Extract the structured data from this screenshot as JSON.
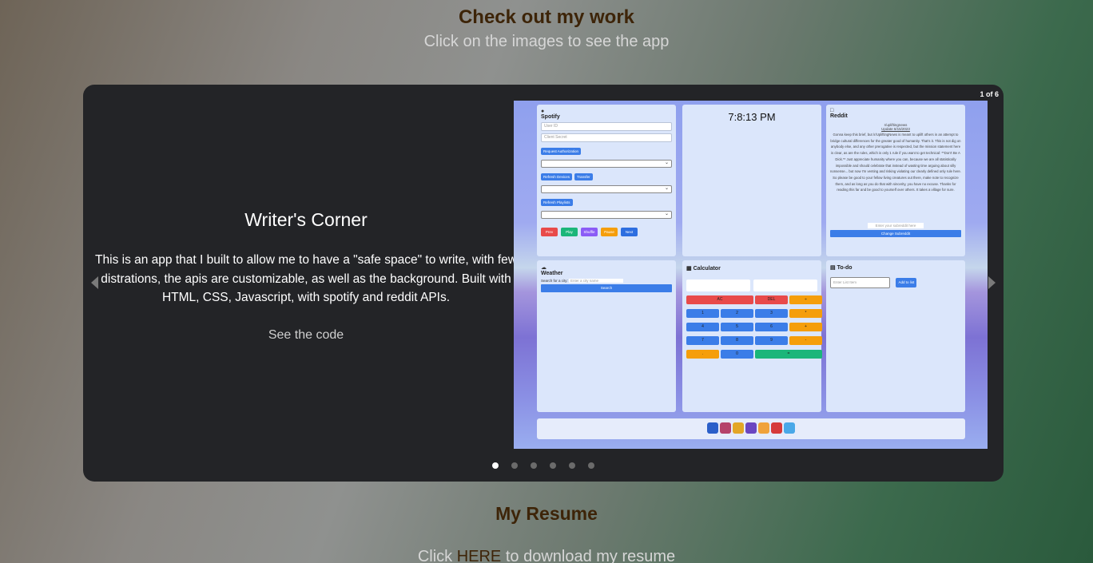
{
  "header": {
    "title": "Check out my work",
    "subtitle": "Click on the images to see the app"
  },
  "carousel": {
    "counter": "1 of 6",
    "slide_count": 6,
    "active_index": 0,
    "project": {
      "title": "Writer's Corner",
      "description": "This is an app that I built to allow me to have a \"safe space\" to write, with few distrations, the apis are customizable, as well as the background. Built with HTML, CSS, Javascript, with spotify and reddit APIs.",
      "link_label": "See the code"
    },
    "preview": {
      "spotify": {
        "icon": "spotify-icon",
        "title": "Spotify",
        "user_id_placeholder": "User ID",
        "client_secret_placeholder": "Client Secret",
        "request_auth": "Request Authorization",
        "refresh_devices": "Refresh Devices",
        "transfer": "Transfer",
        "refresh_playlists": "Refresh Playlists",
        "controls": [
          "Prev",
          "Play",
          "Shuffle",
          "Pause",
          "Next"
        ]
      },
      "clock": {
        "time": "7:8:13 PM"
      },
      "reddit": {
        "icon": "trash-icon",
        "title": "Reddit",
        "subreddit": "r/upliftingnews",
        "update": "Update 6/15/2023",
        "body": "Gonna keep this brief, but /r/UpliftingNews is meant to uplift others in an attempt to bridge cultural differences for the greater good of humanity. That's it. This is not dig on anybody else, and any other prerogative is respected, but the mission statement here is clear, as are the rules, which is only 1 rule if you want to get technical: **Don't Be A Dick.** Just appreciate humanity where you can, because we are all statistically impossible and should celebrate that instead of wasting time arguing about silly nonsense... but now I'm venting and risking violating our clearly defined only rule here. So please be good to your fellow living creatures out there, make note to recognize them, and as long as you do that with sincerity, you have no excuse. Thanks for reading this far and be good to yourself over others. It takes a village for sure.",
        "input_placeholder": "Enter your subreddit here",
        "button": "Change Subreddit"
      },
      "weather": {
        "icon": "cloud-icon",
        "title": "Weather",
        "label": "Search for a city:",
        "placeholder": "Enter a city name",
        "button": "Search"
      },
      "calculator": {
        "icon": "calculator-icon",
        "title": "Calculator",
        "keys": [
          "AC",
          "DEL",
          "÷",
          "1",
          "2",
          "3",
          "*",
          "4",
          "5",
          "6",
          "+",
          "7",
          "8",
          "9",
          "-",
          ".",
          "0",
          "="
        ]
      },
      "todo": {
        "icon": "clipboard-icon",
        "title": "To-do",
        "placeholder": "Enter List Item",
        "button": "Add to list"
      }
    }
  },
  "resume": {
    "title": "My Resume",
    "prefix": "Click ",
    "link": "HERE",
    "suffix": " to download my resume"
  }
}
